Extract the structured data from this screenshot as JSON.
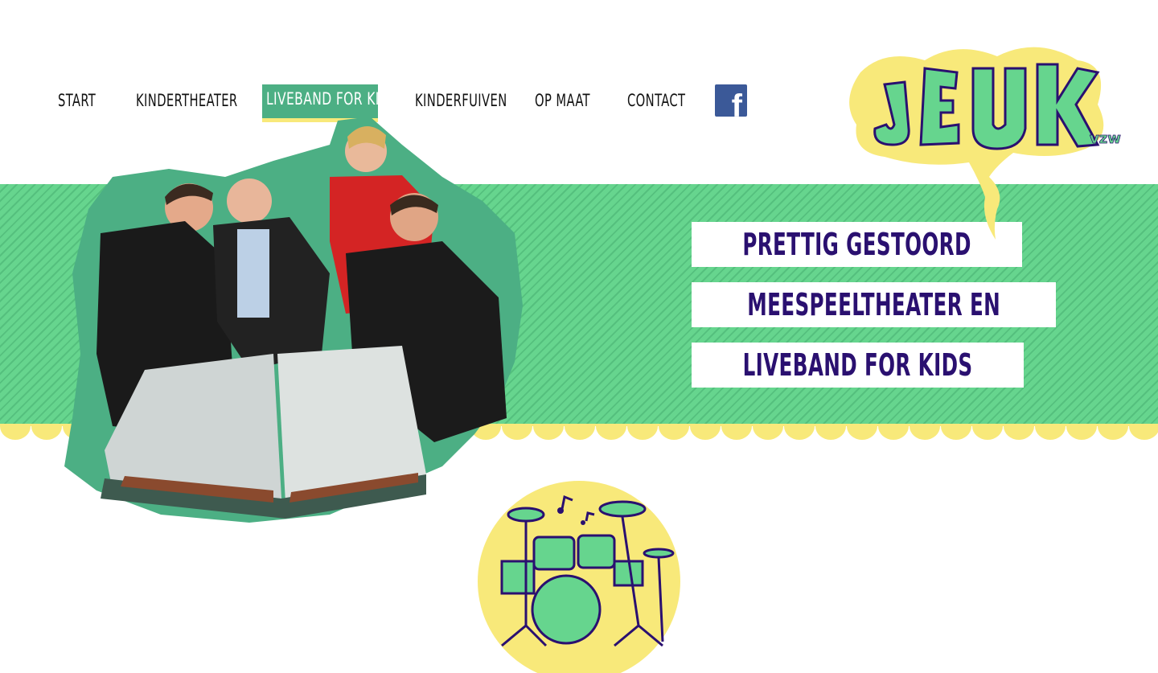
{
  "nav": {
    "items": [
      "START",
      "KINDERTHEATER",
      "LIVEBAND FOR KIDS",
      "KINDERFUIVEN",
      "OP MAAT",
      "CONTACT"
    ],
    "active": "LIVEBAND FOR KIDS",
    "facebook_icon": "facebook-icon"
  },
  "logo": {
    "text": "JEUK",
    "suffix": "vzw"
  },
  "slogan": [
    "PRETTIG GESTOORD",
    "MEESPEELTHEATER EN",
    "LIVEBAND FOR KIDS"
  ],
  "colors": {
    "green": "#66d58e",
    "dark_green": "#4caf84",
    "yellow": "#f8e97a",
    "navy": "#2a1070",
    "facebook": "#3b5998"
  },
  "images": {
    "band_photo": "band-photo",
    "drum_icon": "drum-kit-icon"
  }
}
